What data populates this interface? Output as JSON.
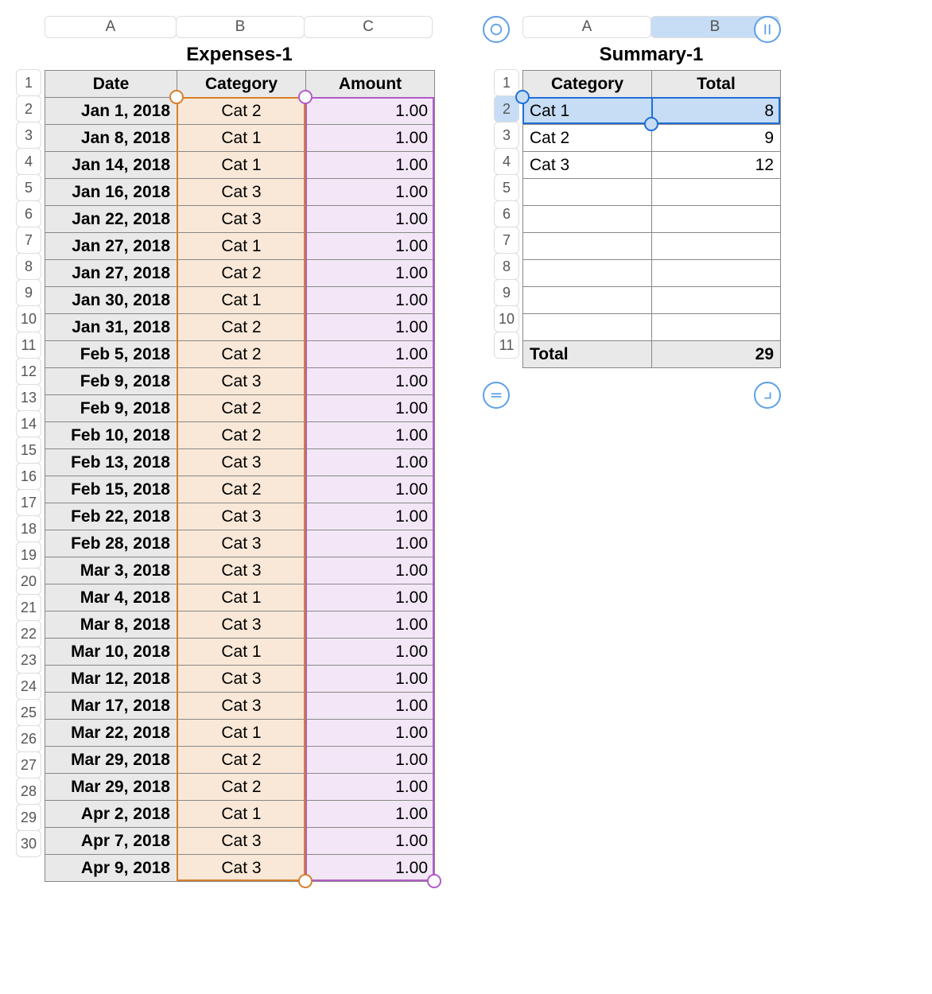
{
  "expenses": {
    "title": "Expenses-1",
    "cols": [
      "A",
      "B",
      "C"
    ],
    "headers": [
      "Date",
      "Category",
      "Amount"
    ],
    "rows": [
      {
        "n": "1"
      },
      {
        "n": "2",
        "date": "Jan 1, 2018",
        "cat": "Cat 2",
        "amt": "1.00"
      },
      {
        "n": "3",
        "date": "Jan 8, 2018",
        "cat": "Cat 1",
        "amt": "1.00"
      },
      {
        "n": "4",
        "date": "Jan 14, 2018",
        "cat": "Cat 1",
        "amt": "1.00"
      },
      {
        "n": "5",
        "date": "Jan 16, 2018",
        "cat": "Cat 3",
        "amt": "1.00"
      },
      {
        "n": "6",
        "date": "Jan 22, 2018",
        "cat": "Cat 3",
        "amt": "1.00"
      },
      {
        "n": "7",
        "date": "Jan 27, 2018",
        "cat": "Cat 1",
        "amt": "1.00"
      },
      {
        "n": "8",
        "date": "Jan 27, 2018",
        "cat": "Cat 2",
        "amt": "1.00"
      },
      {
        "n": "9",
        "date": "Jan 30, 2018",
        "cat": "Cat 1",
        "amt": "1.00"
      },
      {
        "n": "10",
        "date": "Jan 31, 2018",
        "cat": "Cat 2",
        "amt": "1.00"
      },
      {
        "n": "11",
        "date": "Feb 5, 2018",
        "cat": "Cat 2",
        "amt": "1.00"
      },
      {
        "n": "12",
        "date": "Feb 9, 2018",
        "cat": "Cat 3",
        "amt": "1.00"
      },
      {
        "n": "13",
        "date": "Feb 9, 2018",
        "cat": "Cat 2",
        "amt": "1.00"
      },
      {
        "n": "14",
        "date": "Feb 10, 2018",
        "cat": "Cat 2",
        "amt": "1.00"
      },
      {
        "n": "15",
        "date": "Feb 13, 2018",
        "cat": "Cat 3",
        "amt": "1.00"
      },
      {
        "n": "16",
        "date": "Feb 15, 2018",
        "cat": "Cat 2",
        "amt": "1.00"
      },
      {
        "n": "17",
        "date": "Feb 22, 2018",
        "cat": "Cat 3",
        "amt": "1.00"
      },
      {
        "n": "18",
        "date": "Feb 28, 2018",
        "cat": "Cat 3",
        "amt": "1.00"
      },
      {
        "n": "19",
        "date": "Mar 3, 2018",
        "cat": "Cat 3",
        "amt": "1.00"
      },
      {
        "n": "20",
        "date": "Mar 4, 2018",
        "cat": "Cat 1",
        "amt": "1.00"
      },
      {
        "n": "21",
        "date": "Mar 8, 2018",
        "cat": "Cat 3",
        "amt": "1.00"
      },
      {
        "n": "22",
        "date": "Mar 10, 2018",
        "cat": "Cat 1",
        "amt": "1.00"
      },
      {
        "n": "23",
        "date": "Mar 12, 2018",
        "cat": "Cat 3",
        "amt": "1.00"
      },
      {
        "n": "24",
        "date": "Mar 17, 2018",
        "cat": "Cat 3",
        "amt": "1.00"
      },
      {
        "n": "25",
        "date": "Mar 22, 2018",
        "cat": "Cat 1",
        "amt": "1.00"
      },
      {
        "n": "26",
        "date": "Mar 29, 2018",
        "cat": "Cat 2",
        "amt": "1.00"
      },
      {
        "n": "27",
        "date": "Mar 29, 2018",
        "cat": "Cat 2",
        "amt": "1.00"
      },
      {
        "n": "28",
        "date": "Apr 2, 2018",
        "cat": "Cat 1",
        "amt": "1.00"
      },
      {
        "n": "29",
        "date": "Apr 7, 2018",
        "cat": "Cat 3",
        "amt": "1.00"
      },
      {
        "n": "30",
        "date": "Apr 9, 2018",
        "cat": "Cat 3",
        "amt": "1.00"
      }
    ]
  },
  "summary": {
    "title": "Summary-1",
    "cols": [
      "A",
      "B"
    ],
    "headers": [
      "Category",
      "Total"
    ],
    "rowNums": [
      "1",
      "2",
      "3",
      "4",
      "5",
      "6",
      "7",
      "8",
      "9",
      "10",
      "11"
    ],
    "data": [
      {
        "cat": "Cat 1",
        "tot": "8"
      },
      {
        "cat": "Cat 2",
        "tot": "9"
      },
      {
        "cat": "Cat 3",
        "tot": "12"
      }
    ],
    "footer": {
      "label": "Total",
      "value": "29"
    },
    "selectedRow": 2,
    "selectedCol": "B"
  }
}
